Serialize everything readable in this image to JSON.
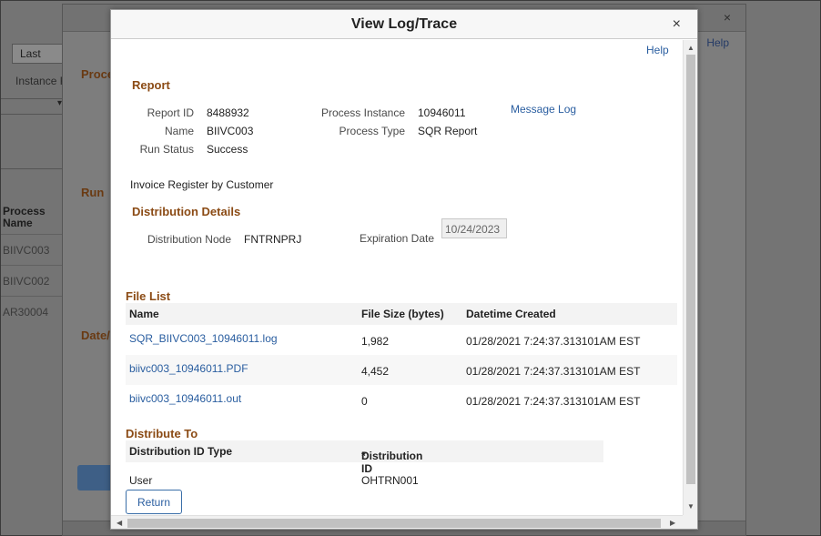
{
  "background": {
    "select_value": "Last",
    "instance_label": "Instance F",
    "column_header_line1": "Process",
    "column_header_line2": "Name",
    "rows": [
      "BIIVC003",
      "BIIVC002",
      "AR30004"
    ]
  },
  "middle": {
    "help_label": "Help",
    "close_symbol": "×",
    "sections": [
      "Proce",
      "Run",
      "Date/T"
    ]
  },
  "dialog": {
    "title": "View Log/Trace",
    "close_symbol": "×",
    "help_label": "Help",
    "report": {
      "section_title": "Report",
      "report_id_label": "Report ID",
      "report_id": "8488932",
      "name_label": "Name",
      "name": "BIIVC003",
      "run_status_label": "Run Status",
      "run_status": "Success",
      "process_instance_label": "Process Instance",
      "process_instance": "10946011",
      "process_type_label": "Process Type",
      "process_type": "SQR Report",
      "message_log_label": "Message Log",
      "description": "Invoice Register by Customer"
    },
    "distribution_details": {
      "section_title": "Distribution Details",
      "node_label": "Distribution Node",
      "node": "FNTRNPRJ",
      "expiration_label": "Expiration Date",
      "expiration_date": "10/24/2023"
    },
    "file_list": {
      "section_title": "File List",
      "columns": [
        "Name",
        "File Size (bytes)",
        "Datetime Created"
      ],
      "rows": [
        {
          "name": "SQR_BIIVC003_10946011.log",
          "size": "1,982",
          "created": "01/28/2021  7:24:37.313101AM EST"
        },
        {
          "name": "biivc003_10946011.PDF",
          "size": "4,452",
          "created": "01/28/2021  7:24:37.313101AM EST"
        },
        {
          "name": "biivc003_10946011.out",
          "size": "0",
          "created": "01/28/2021  7:24:37.313101AM EST"
        }
      ]
    },
    "distribute_to": {
      "section_title": "Distribute To",
      "columns": [
        "Distribution ID Type",
        "Distribution ID"
      ],
      "required_marker": "*",
      "rows": [
        {
          "type": "User",
          "id": "OHTRN001"
        }
      ]
    },
    "return_label": "Return"
  }
}
